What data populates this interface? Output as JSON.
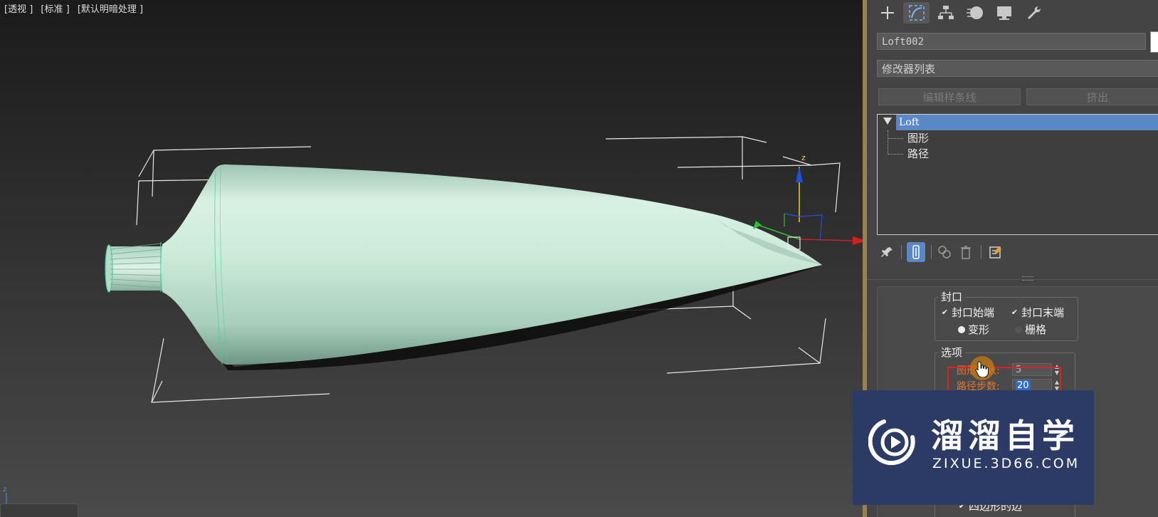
{
  "viewport": {
    "labels": [
      "[透视 ]",
      "[标准 ]",
      "[默认明暗处理 ]"
    ],
    "gizmo_z_label": "z",
    "mini_axis_label": "z"
  },
  "panel": {
    "tabs": [
      {
        "name": "create",
        "icon": "plus-icon"
      },
      {
        "name": "modify",
        "icon": "modify-curve-icon",
        "active": true
      },
      {
        "name": "hierarchy",
        "icon": "hierarchy-icon"
      },
      {
        "name": "motion",
        "icon": "motion-icon"
      },
      {
        "name": "display",
        "icon": "monitor-icon"
      },
      {
        "name": "utilities",
        "icon": "wrench-icon"
      }
    ],
    "object_name": "Loft002",
    "modifier_list": "修改器列表",
    "buttons": {
      "edit_spline": "编辑样条线",
      "extrude": "挤出"
    },
    "stack": {
      "root": "Loft",
      "children": [
        "图形",
        "路径"
      ]
    },
    "rollout": {
      "cap_group_title": "封口",
      "cap_start": "封口始端",
      "cap_end": "封口末端",
      "morph": "变形",
      "grid": "栅格",
      "options_title": "选项",
      "shape_steps_label": "图形步数:",
      "shape_steps_value": "5",
      "path_steps_label": "路径步数:",
      "path_steps_value": "20",
      "quad_sides": "四边形的边"
    }
  },
  "watermark": {
    "title": "溜溜自学",
    "url": "ZIXUE.3D66.COM"
  },
  "colors": {
    "viewport_bg": "#2b2b2b",
    "panel_bg": "#444444",
    "selection_blue": "#5a87c5",
    "object_mint": "#c8e8d8",
    "highlight_red": "#e02020",
    "watermark_bg": "#2c3a66",
    "divider_gold": "#9a8050"
  }
}
